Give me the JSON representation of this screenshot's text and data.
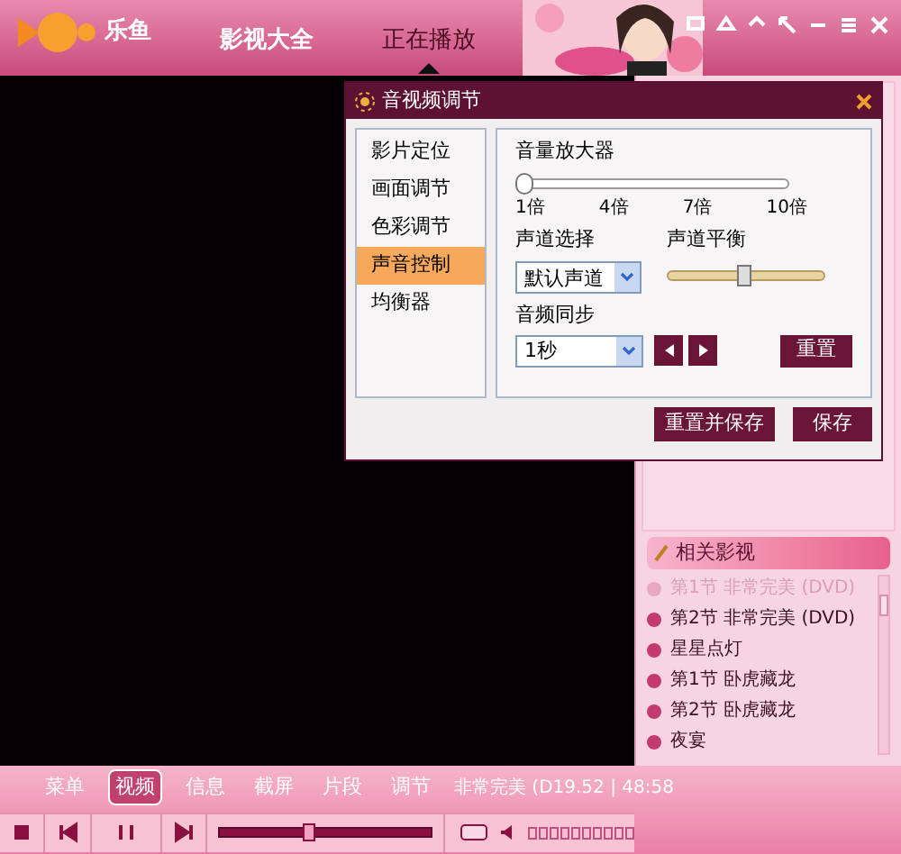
{
  "app": {
    "name": "乐鱼"
  },
  "nav": [
    {
      "label": "影视大全",
      "selected": false
    },
    {
      "label": "正在播放",
      "selected": true
    }
  ],
  "dialog": {
    "title": "音视频调节",
    "menu": [
      {
        "label": "影片定位",
        "selected": false
      },
      {
        "label": "画面调节",
        "selected": false
      },
      {
        "label": "色彩调节",
        "selected": false
      },
      {
        "label": "声音控制",
        "selected": true
      },
      {
        "label": "均衡器",
        "selected": false
      }
    ],
    "volume_amplifier": {
      "label": "音量放大器",
      "level": 0,
      "ticks": [
        "1倍",
        "4倍",
        "7倍",
        "10倍"
      ]
    },
    "channel_select": {
      "label": "声道选择",
      "value": "默认声道"
    },
    "channel_balance": {
      "label": "声道平衡",
      "level": 0.5
    },
    "audio_sync": {
      "label": "音频同步",
      "value": "1秒"
    },
    "reset_button": "重置",
    "buttons": [
      "重置并保存",
      "保存"
    ]
  },
  "toolbar": {
    "tabs": [
      {
        "label": "菜单",
        "selected": false
      },
      {
        "label": "视频",
        "selected": true
      },
      {
        "label": "信息",
        "selected": false
      },
      {
        "label": "截屏",
        "selected": false
      },
      {
        "label": "片段",
        "selected": false
      },
      {
        "label": "调节",
        "selected": false
      }
    ],
    "now_playing": "非常完美 (D19.52 | 48:58"
  },
  "player": {
    "progress": {
      "level": 0.42
    }
  },
  "related": {
    "title": "相关影视",
    "items": [
      {
        "title": "第1节 非常完美 (DVD)",
        "disabled": true
      },
      {
        "title": "第2节 非常完美 (DVD)",
        "disabled": false
      },
      {
        "title": "星星点灯",
        "disabled": false
      },
      {
        "title": "第1节 卧虎藏龙",
        "disabled": false
      },
      {
        "title": "第2节 卧虎藏龙",
        "disabled": false
      },
      {
        "title": "夜宴",
        "disabled": false
      }
    ]
  }
}
